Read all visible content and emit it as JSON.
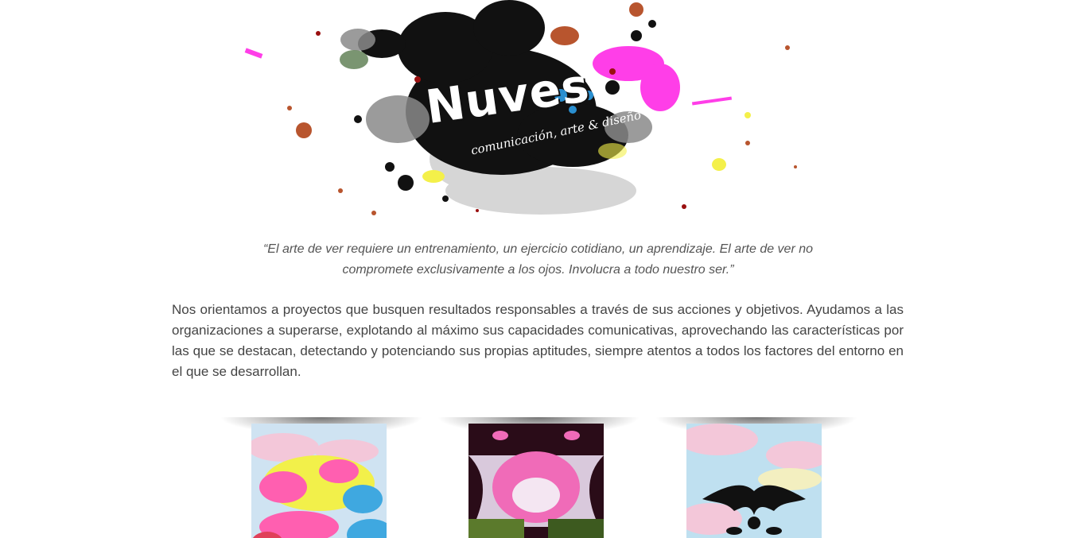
{
  "header": {
    "brand_name": "Nuves",
    "tagline": "comunicación, arte & diseño",
    "colors": {
      "ink": "#111111",
      "magenta": "#ff3ee8",
      "rust": "#b8552e",
      "blue": "#2a8fd0",
      "yellow": "#f4f04a"
    }
  },
  "quote": {
    "line1": "“El arte de ver requiere un entrenamiento, un ejercicio cotidiano, un aprendizaje. El arte de ver no",
    "line2": "compromete exclusivamente a los ojos. Involucra a todo nuestro ser.”"
  },
  "intro": {
    "text": "Nos orientamos a proyectos que busquen resultados responsables a través de sus acciones y objetivos. Ayudamos a las organizaciones a superarse, explotando al máximo sus capacidades comunicativas, aprovechando las características por las que se destacan, detectando y potenciando sus propias aptitudes, siempre atentos a todos los factores del entorno en el que se desarrollan."
  },
  "gallery": {
    "items": [
      {
        "name": "colorful-paint-splash-artwork",
        "colors": [
          "#f2f04a",
          "#ff5fb0",
          "#3fa8e0",
          "#cfe3f2"
        ]
      },
      {
        "name": "symmetric-inkblot-pink-dark-artwork",
        "colors": [
          "#2a0c18",
          "#f06bb8",
          "#5b7a2c",
          "#d9c9dc"
        ]
      },
      {
        "name": "black-inkblot-on-pastel-artwork",
        "colors": [
          "#111111",
          "#f3c7d9",
          "#bfe0f0",
          "#f3efc0"
        ]
      }
    ]
  }
}
